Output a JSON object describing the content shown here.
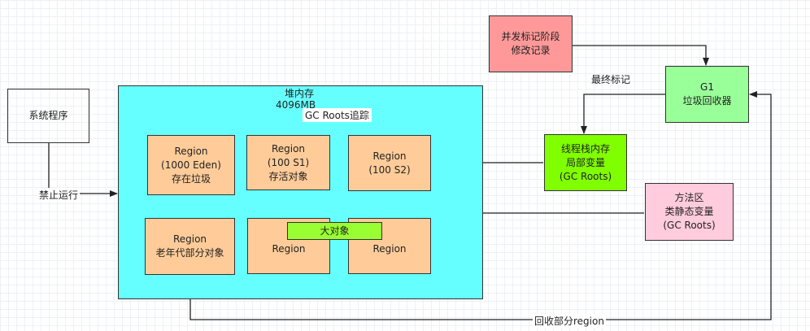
{
  "colors": {
    "heap": "#66ffff",
    "region": "#ffcc99",
    "program": "#e5ccff",
    "concurrent": "#ff9999",
    "g1": "#99ff99",
    "stack": "#80ff00",
    "method": "#ffccdd",
    "large": "#99ff33"
  },
  "program": {
    "label": "系统程序"
  },
  "stop_label": "禁止运行",
  "heap": {
    "title": "堆内存",
    "size": "4096MB"
  },
  "gc_roots_trace": "GC Roots追踪",
  "regions": {
    "eden": [
      "Region",
      "(1000 Eden)",
      "存在垃圾"
    ],
    "s1": [
      "Region",
      "(100 S1)",
      "存活对象"
    ],
    "s2": [
      "Region",
      "(100 S2)"
    ],
    "old": [
      "Region",
      "老年代部分对象"
    ],
    "mid": "Region",
    "right": "Region"
  },
  "large_object": "大对象",
  "concurrent_mark": [
    "并发标记阶段",
    "修改记录"
  ],
  "final_mark": "最终标记",
  "g1": [
    "G1",
    "垃圾回收器"
  ],
  "stack": [
    "线程栈内存",
    "局部变量",
    "(GC Roots)"
  ],
  "method_area": [
    "方法区",
    "类静态变量",
    "(GC Roots)"
  ],
  "reclaim": "回收部分region"
}
